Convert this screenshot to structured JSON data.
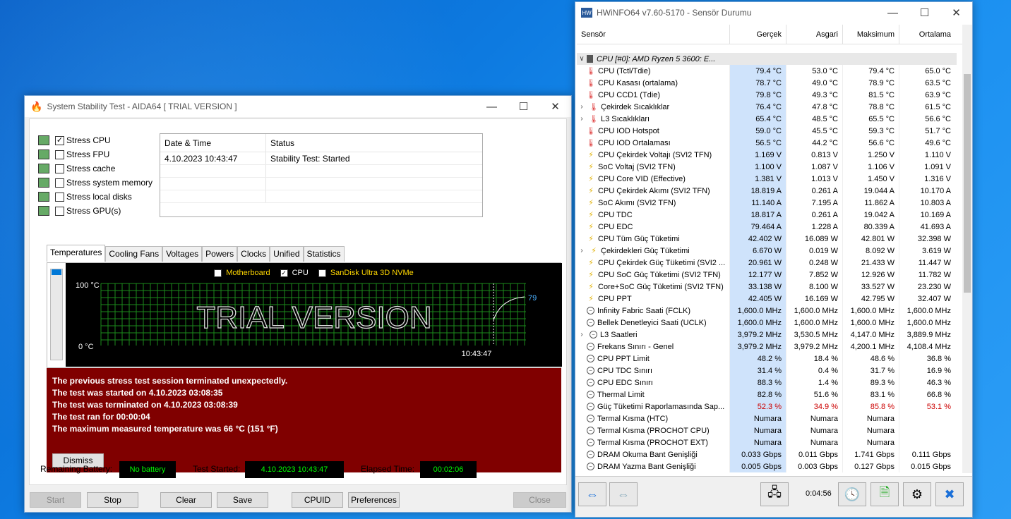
{
  "aida": {
    "title": "System Stability Test - AIDA64  [ TRIAL VERSION ]",
    "stress_items": [
      {
        "label": "Stress CPU",
        "checked": true,
        "icon": "cpu-chip-icon"
      },
      {
        "label": "Stress FPU",
        "checked": false,
        "icon": "fpu-icon"
      },
      {
        "label": "Stress cache",
        "checked": false,
        "icon": "cache-icon"
      },
      {
        "label": "Stress system memory",
        "checked": false,
        "icon": "memory-icon"
      },
      {
        "label": "Stress local disks",
        "checked": false,
        "icon": "disk-icon"
      },
      {
        "label": "Stress GPU(s)",
        "checked": false,
        "icon": "gpu-icon"
      }
    ],
    "log": {
      "col_date": "Date & Time",
      "col_status": "Status",
      "rows": [
        {
          "date": "4.10.2023 10:43:47",
          "status": "Stability Test: Started"
        }
      ]
    },
    "tabs": [
      "Temperatures",
      "Cooling Fans",
      "Voltages",
      "Powers",
      "Clocks",
      "Unified",
      "Statistics"
    ],
    "chart": {
      "legend": [
        {
          "label": "Motherboard",
          "checked": false,
          "color": "#ffd700"
        },
        {
          "label": "CPU",
          "checked": true,
          "color": "#ffffff"
        },
        {
          "label": "SanDisk Ultra 3D NVMe",
          "checked": false,
          "color": "#ffd700"
        }
      ],
      "y_top": "100 °C",
      "y_bottom": "0 °C",
      "watermark": "TRIAL VERSION",
      "time": "10:43:47",
      "current_value": "79"
    },
    "error": {
      "lines": [
        "The previous stress test session terminated unexpectedly.",
        "The test was started on 4.10.2023 03:08:35",
        "The test was terminated on 4.10.2023 03:08:39",
        "The test ran for 00:00:04",
        "The maximum measured temperature was 66 °C  (151 °F)"
      ],
      "dismiss": "Dismiss"
    },
    "status": {
      "battery_label": "Remaining Battery:",
      "battery": "No battery",
      "started_label": "Test Started:",
      "started": "4.10.2023 10:43:47",
      "elapsed_label": "Elapsed Time:",
      "elapsed": "00:02:06"
    },
    "buttons": {
      "start": "Start",
      "stop": "Stop",
      "clear": "Clear",
      "save": "Save",
      "cpuid": "CPUID",
      "preferences": "Preferences",
      "close": "Close"
    }
  },
  "hw": {
    "title": "HWiNFO64 v7.60-5170 - Sensör Durumu",
    "headers": [
      "Sensör",
      "Gerçek",
      "Asgari",
      "Maksimum",
      "Ortalama"
    ],
    "group": "CPU [#0]: AMD Ryzen 5 3600: E...",
    "rows": [
      {
        "n": "CPU (Tctl/Tdie)",
        "i": "therm",
        "c": "79.4 °C",
        "a": "53.0 °C",
        "m": "79.4 °C",
        "o": "65.0 °C"
      },
      {
        "n": "CPU Kasası (ortalama)",
        "i": "therm",
        "c": "78.7 °C",
        "a": "49.0 °C",
        "m": "78.9 °C",
        "o": "63.5 °C"
      },
      {
        "n": "CPU CCD1 (Tdie)",
        "i": "therm",
        "c": "79.8 °C",
        "a": "49.3 °C",
        "m": "81.5 °C",
        "o": "63.9 °C"
      },
      {
        "n": "Çekirdek Sıcaklıklar",
        "i": "therm",
        "e": true,
        "c": "76.4 °C",
        "a": "47.8 °C",
        "m": "78.8 °C",
        "o": "61.5 °C"
      },
      {
        "n": "L3 Sıcaklıkları",
        "i": "therm",
        "e": true,
        "c": "65.4 °C",
        "a": "48.5 °C",
        "m": "65.5 °C",
        "o": "56.6 °C"
      },
      {
        "n": "CPU IOD Hotspot",
        "i": "therm",
        "c": "59.0 °C",
        "a": "45.5 °C",
        "m": "59.3 °C",
        "o": "51.7 °C"
      },
      {
        "n": "CPU IOD Ortalaması",
        "i": "therm",
        "c": "56.5 °C",
        "a": "44.2 °C",
        "m": "56.6 °C",
        "o": "49.6 °C"
      },
      {
        "n": "CPU Çekirdek Voltajı (SVI2 TFN)",
        "i": "bolt",
        "c": "1.169 V",
        "a": "0.813 V",
        "m": "1.250 V",
        "o": "1.110 V"
      },
      {
        "n": "SoC Voltaj (SVI2 TFN)",
        "i": "bolt",
        "c": "1.100 V",
        "a": "1.087 V",
        "m": "1.106 V",
        "o": "1.091 V"
      },
      {
        "n": "CPU Core VID (Effective)",
        "i": "bolt",
        "c": "1.381 V",
        "a": "1.013 V",
        "m": "1.450 V",
        "o": "1.316 V"
      },
      {
        "n": "CPU Çekirdek Akımı (SVI2 TFN)",
        "i": "bolt",
        "c": "18.819 A",
        "a": "0.261 A",
        "m": "19.044 A",
        "o": "10.170 A"
      },
      {
        "n": "SoC Akımı (SVI2 TFN)",
        "i": "bolt",
        "c": "11.140 A",
        "a": "7.195 A",
        "m": "11.862 A",
        "o": "10.803 A"
      },
      {
        "n": "CPU TDC",
        "i": "bolt",
        "c": "18.817 A",
        "a": "0.261 A",
        "m": "19.042 A",
        "o": "10.169 A"
      },
      {
        "n": "CPU EDC",
        "i": "bolt",
        "c": "79.464 A",
        "a": "1.228 A",
        "m": "80.339 A",
        "o": "41.693 A"
      },
      {
        "n": "CPU Tüm Güç Tüketimi",
        "i": "bolt",
        "c": "42.402 W",
        "a": "16.089 W",
        "m": "42.801 W",
        "o": "32.398 W"
      },
      {
        "n": "Çekirdekleri Güç Tüketimi",
        "i": "bolt",
        "e": true,
        "c": "6.670 W",
        "a": "0.019 W",
        "m": "8.092 W",
        "o": "3.619 W"
      },
      {
        "n": "CPU Çekirdek Güç Tüketimi (SVI2 ...",
        "i": "bolt",
        "c": "20.961 W",
        "a": "0.248 W",
        "m": "21.433 W",
        "o": "11.447 W"
      },
      {
        "n": "CPU SoC Güç Tüketimi (SVI2 TFN)",
        "i": "bolt",
        "c": "12.177 W",
        "a": "7.852 W",
        "m": "12.926 W",
        "o": "11.782 W"
      },
      {
        "n": "Core+SoC Güç Tüketimi (SVI2 TFN)",
        "i": "bolt",
        "c": "33.138 W",
        "a": "8.100 W",
        "m": "33.527 W",
        "o": "23.230 W"
      },
      {
        "n": "CPU PPT",
        "i": "bolt",
        "c": "42.405 W",
        "a": "16.169 W",
        "m": "42.795 W",
        "o": "32.407 W"
      },
      {
        "n": "Infinity Fabric Saati (FCLK)",
        "i": "clk",
        "c": "1,600.0 MHz",
        "a": "1,600.0 MHz",
        "m": "1,600.0 MHz",
        "o": "1,600.0 MHz"
      },
      {
        "n": "Bellek Denetleyici Saati (UCLK)",
        "i": "clk",
        "c": "1,600.0 MHz",
        "a": "1,600.0 MHz",
        "m": "1,600.0 MHz",
        "o": "1,600.0 MHz"
      },
      {
        "n": "L3 Saatleri",
        "i": "clk",
        "e": true,
        "c": "3,979.2 MHz",
        "a": "3,530.5 MHz",
        "m": "4,147.0 MHz",
        "o": "3,889.9 MHz"
      },
      {
        "n": "Frekans Sınırı - Genel",
        "i": "clk",
        "c": "3,979.2 MHz",
        "a": "3,979.2 MHz",
        "m": "4,200.1 MHz",
        "o": "4,108.4 MHz"
      },
      {
        "n": "CPU PPT Limit",
        "i": "clk",
        "c": "48.2 %",
        "a": "18.4 %",
        "m": "48.6 %",
        "o": "36.8 %"
      },
      {
        "n": "CPU TDC Sınırı",
        "i": "clk",
        "c": "31.4 %",
        "a": "0.4 %",
        "m": "31.7 %",
        "o": "16.9 %"
      },
      {
        "n": "CPU EDC Sınırı",
        "i": "clk",
        "c": "88.3 %",
        "a": "1.4 %",
        "m": "89.3 %",
        "o": "46.3 %"
      },
      {
        "n": "Thermal Limit",
        "i": "clk",
        "c": "82.8 %",
        "a": "51.6 %",
        "m": "83.1 %",
        "o": "66.8 %"
      },
      {
        "n": "Güç Tüketimi Raporlamasında Sap...",
        "i": "clk",
        "red": true,
        "c": "52.3 %",
        "a": "34.9 %",
        "m": "85.8 %",
        "o": "53.1 %"
      },
      {
        "n": "Termal Kısma (HTC)",
        "i": "clk",
        "c": "Numara",
        "a": "Numara",
        "m": "Numara",
        "o": ""
      },
      {
        "n": "Termal Kısma (PROCHOT CPU)",
        "i": "clk",
        "c": "Numara",
        "a": "Numara",
        "m": "Numara",
        "o": ""
      },
      {
        "n": "Termal Kısma (PROCHOT EXT)",
        "i": "clk",
        "c": "Numara",
        "a": "Numara",
        "m": "Numara",
        "o": ""
      },
      {
        "n": "DRAM Okuma Bant Genişliği",
        "i": "clk",
        "c": "0.033 Gbps",
        "a": "0.011 Gbps",
        "m": "1.741 Gbps",
        "o": "0.111 Gbps"
      },
      {
        "n": "DRAM Yazma Bant Genişliği",
        "i": "clk",
        "c": "0.005 Gbps",
        "a": "0.003 Gbps",
        "m": "0.127 Gbps",
        "o": "0.015 Gbps"
      }
    ],
    "timer": "0:04:56"
  }
}
